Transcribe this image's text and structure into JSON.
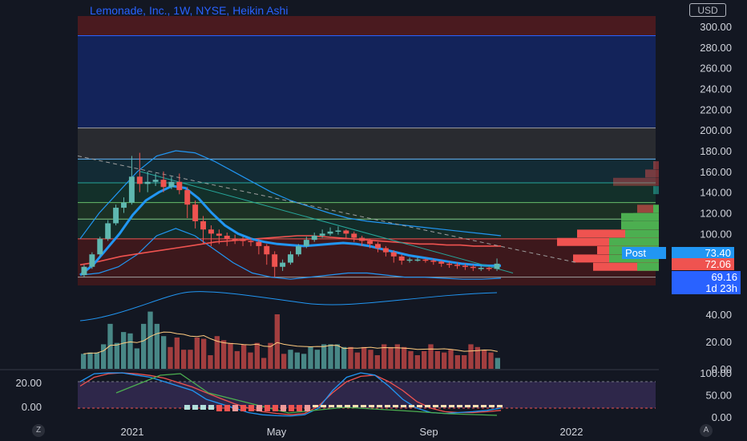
{
  "title": "Lemonade, Inc., 1W, NYSE, Heikin Ashi",
  "currency": "USD",
  "buttons": {
    "left": "Z",
    "right": "A"
  },
  "price_tags": {
    "post_label": "Post",
    "post_value": "73.40",
    "close_value": "72.06",
    "ma_value": "69.16",
    "countdown": "1d 23h"
  },
  "colors": {
    "bg": "#131722",
    "up": "#5fb8b0",
    "down": "#ef5350",
    "blue": "#2196f3",
    "accent": "#2962ff"
  },
  "chart_data": [
    {
      "type": "candlestick",
      "title": "Lemonade, Inc., 1W, NYSE, Heikin Ashi",
      "ylim": [
        50,
        310
      ],
      "yticks": [
        "300.00",
        "280.00",
        "260.00",
        "240.00",
        "220.00",
        "200.00",
        "180.00",
        "160.00",
        "140.00",
        "120.00",
        "100.00"
      ],
      "x_labels": [
        "2021",
        "May",
        "Sep",
        "2022"
      ],
      "fib_levels": [
        291,
        202,
        172,
        149,
        130,
        114,
        95,
        58
      ],
      "candles": [
        [
          60,
          68,
          58,
          70
        ],
        [
          68,
          80,
          66,
          82
        ],
        [
          80,
          95,
          78,
          97
        ],
        [
          95,
          110,
          93,
          113
        ],
        [
          110,
          125,
          108,
          128
        ],
        [
          125,
          130,
          120,
          135
        ],
        [
          130,
          155,
          128,
          175
        ],
        [
          155,
          148,
          140,
          178
        ],
        [
          148,
          150,
          140,
          160
        ],
        [
          150,
          152,
          146,
          158
        ],
        [
          152,
          145,
          140,
          160
        ],
        [
          145,
          150,
          143,
          155
        ],
        [
          150,
          142,
          138,
          158
        ],
        [
          142,
          128,
          115,
          145
        ],
        [
          128,
          112,
          105,
          132
        ],
        [
          112,
          104,
          90,
          117
        ],
        [
          104,
          100,
          88,
          108
        ],
        [
          100,
          98,
          90,
          104
        ],
        [
          98,
          95,
          88,
          101
        ],
        [
          95,
          94,
          90,
          99
        ],
        [
          94,
          93,
          88,
          97
        ],
        [
          93,
          92,
          88,
          96
        ],
        [
          92,
          88,
          80,
          94
        ],
        [
          88,
          80,
          70,
          90
        ],
        [
          80,
          68,
          58,
          83
        ],
        [
          68,
          72,
          64,
          75
        ],
        [
          72,
          80,
          70,
          83
        ],
        [
          80,
          88,
          78,
          90
        ],
        [
          88,
          94,
          86,
          97
        ],
        [
          94,
          98,
          92,
          101
        ],
        [
          98,
          100,
          96,
          104
        ],
        [
          100,
          102,
          98,
          106
        ],
        [
          102,
          103,
          99,
          107
        ],
        [
          103,
          100,
          96,
          104
        ],
        [
          100,
          96,
          92,
          102
        ],
        [
          96,
          93,
          88,
          98
        ],
        [
          93,
          90,
          86,
          95
        ],
        [
          90,
          86,
          82,
          92
        ],
        [
          86,
          82,
          78,
          88
        ],
        [
          82,
          78,
          72,
          84
        ],
        [
          78,
          74,
          70,
          80
        ],
        [
          74,
          75,
          72,
          77
        ],
        [
          75,
          75,
          73,
          77
        ],
        [
          75,
          74,
          72,
          76
        ],
        [
          74,
          73,
          70,
          76
        ],
        [
          73,
          71,
          68,
          74
        ],
        [
          71,
          70,
          67,
          73
        ],
        [
          70,
          69,
          66,
          72
        ],
        [
          69,
          68,
          65,
          71
        ],
        [
          68,
          67,
          64,
          70
        ],
        [
          67,
          67,
          64,
          69
        ],
        [
          67,
          66,
          64,
          68
        ],
        [
          66,
          71,
          64,
          76
        ]
      ],
      "bollinger_upper": [
        95,
        120,
        140,
        160,
        175,
        180,
        178,
        170,
        160,
        150,
        140,
        132,
        126,
        120,
        115,
        112,
        110,
        108,
        106,
        104,
        102,
        100,
        98
      ],
      "bollinger_lower": [
        60,
        62,
        68,
        80,
        98,
        105,
        98,
        85,
        72,
        62,
        58,
        56,
        58,
        60,
        62,
        62,
        60,
        58,
        58,
        57,
        56,
        56,
        57
      ],
      "ma_fast": [
        60,
        70,
        85,
        100,
        118,
        132,
        140,
        146,
        144,
        134,
        120,
        108,
        100,
        95,
        92,
        90,
        89,
        88,
        89,
        90,
        91,
        90,
        88,
        85,
        82,
        79,
        77,
        75,
        73,
        71,
        70,
        69,
        69
      ],
      "ma_slow": [
        70,
        72,
        75,
        78,
        80,
        82,
        84,
        86,
        88,
        90,
        92,
        93,
        94,
        95,
        96,
        97,
        98,
        98,
        97,
        96,
        95,
        94,
        93,
        92,
        91,
        90,
        90,
        89,
        89,
        88,
        88,
        88
      ]
    },
    {
      "type": "bar",
      "title": "Volume",
      "ylim": [
        0,
        50
      ],
      "yticks": [
        "40.00",
        "20.00",
        "0.00"
      ],
      "values": [
        11,
        12,
        12,
        18,
        33,
        19,
        27,
        26,
        15,
        33,
        42,
        33,
        24,
        16,
        23,
        14,
        14,
        23,
        22,
        10,
        24,
        21,
        19,
        13,
        18,
        12,
        19,
        8,
        19,
        40,
        11,
        14,
        12,
        11,
        16,
        14,
        18,
        18,
        18,
        16,
        16,
        12,
        16,
        14,
        10,
        18,
        16,
        18,
        16,
        13,
        10,
        13,
        18,
        13,
        12,
        14,
        10,
        10,
        18,
        16,
        14,
        12,
        8
      ],
      "directions": [
        1,
        1,
        1,
        1,
        1,
        1,
        1,
        1,
        1,
        1,
        1,
        1,
        1,
        -1,
        -1,
        -1,
        -1,
        -1,
        -1,
        -1,
        -1,
        -1,
        -1,
        -1,
        -1,
        -1,
        -1,
        -1,
        -1,
        -1,
        -1,
        1,
        1,
        1,
        1,
        1,
        1,
        1,
        1,
        1,
        -1,
        -1,
        -1,
        -1,
        -1,
        -1,
        -1,
        -1,
        -1,
        -1,
        -1,
        -1,
        -1,
        -1,
        -1,
        -1,
        -1,
        -1,
        -1,
        -1,
        -1,
        -1,
        1
      ]
    },
    {
      "type": "line",
      "title": "Stochastic RSI",
      "ylim": [
        0,
        100
      ],
      "yticks": [
        "100.00",
        "50.00",
        "0.00"
      ],
      "k": [
        80,
        98,
        100,
        100,
        95,
        90,
        80,
        70,
        60,
        40,
        30,
        20,
        10,
        5,
        3,
        2,
        5,
        20,
        60,
        90,
        100,
        95,
        70,
        40,
        20,
        10,
        8,
        10,
        12,
        15,
        20
      ],
      "d": [
        70,
        90,
        98,
        100,
        98,
        94,
        88,
        78,
        68,
        55,
        42,
        30,
        20,
        12,
        8,
        5,
        8,
        25,
        55,
        80,
        92,
        95,
        80,
        60,
        35,
        20,
        12,
        10,
        10,
        12,
        15
      ]
    },
    {
      "type": "bar",
      "title": "Momentum",
      "ylim": [
        -10,
        25
      ],
      "yticks": [
        "20.00",
        "0.00"
      ],
      "values": [
        0,
        0,
        0,
        0,
        0,
        0,
        0,
        0,
        0,
        0,
        0,
        0,
        0,
        0,
        0,
        0,
        0,
        0,
        0,
        0,
        0,
        0,
        0,
        0,
        0,
        0,
        0,
        0,
        0,
        0,
        0,
        0,
        0,
        0,
        0,
        0,
        0,
        0,
        0,
        0,
        0,
        0,
        0,
        0,
        0,
        0,
        0,
        0,
        0,
        0,
        0,
        0,
        0,
        0,
        0,
        0,
        0,
        0,
        0,
        0,
        0,
        0,
        0
      ]
    }
  ]
}
